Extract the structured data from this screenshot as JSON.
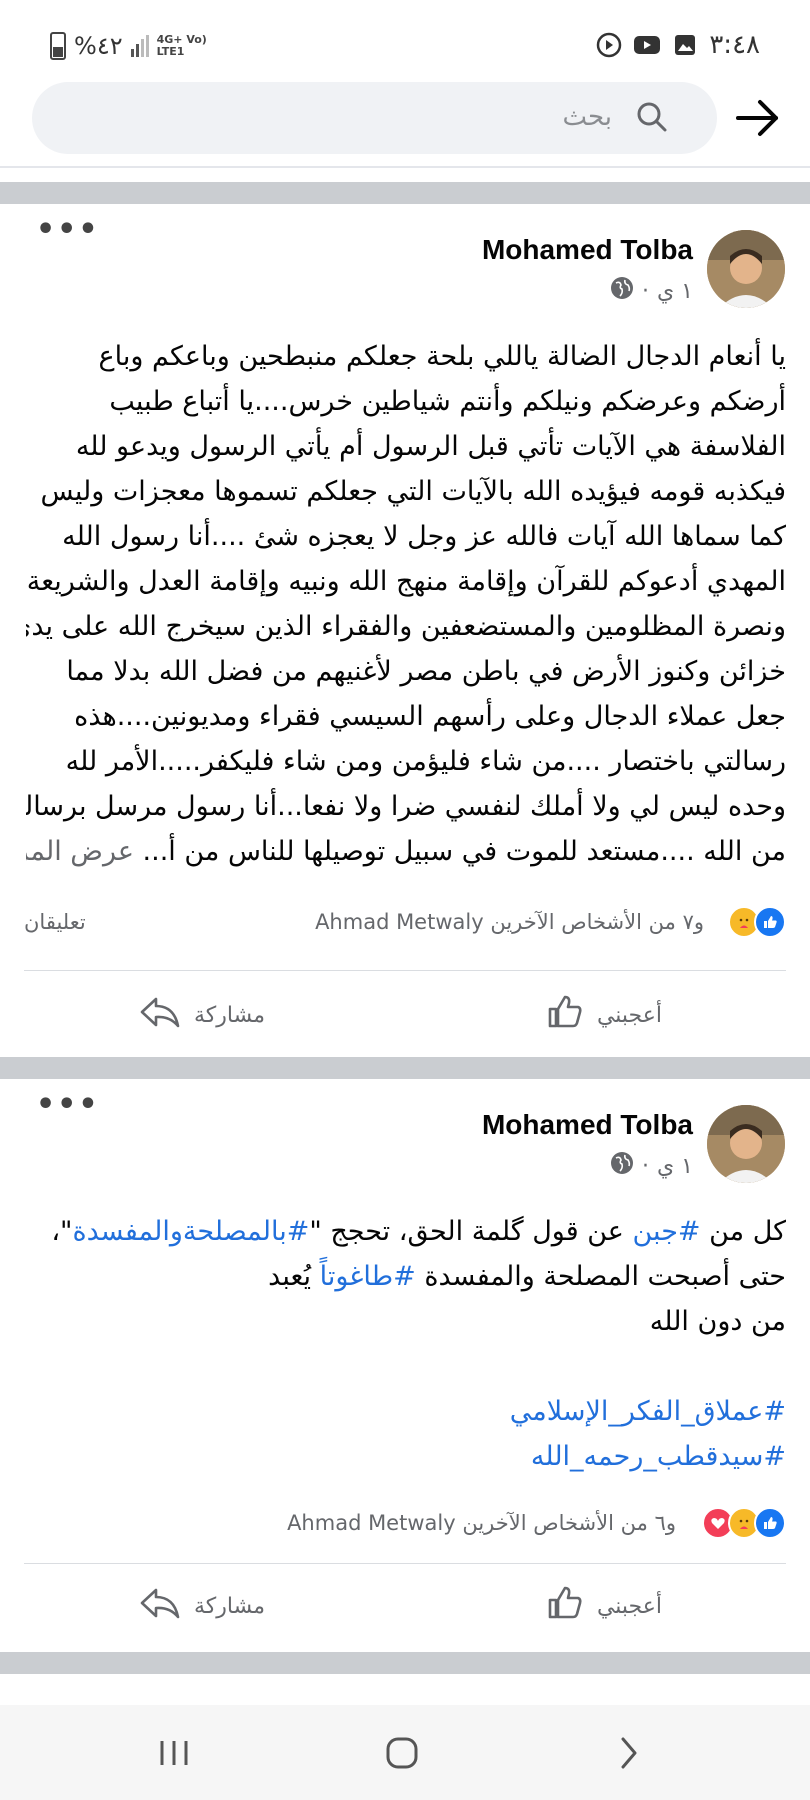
{
  "status_bar": {
    "battery": "%٤٢",
    "network": "4G+ Vo) LTE1",
    "time": "٣:٤٨"
  },
  "search": {
    "placeholder": "بحث"
  },
  "posts": [
    {
      "author": "Mohamed Tolba",
      "time": "١ ي",
      "dot": "·",
      "lines": [
        "يا أنعام الدجال الضالة ياللي بلحة جعلكم منبطحين وباعكم وباع",
        "أرضكم وعرضكم ونيلكم وأنتم شياطين خرس....يا أتباع طبيب",
        "الفلاسفة هي الآيات تأتي قبل الرسول أم يأتي الرسول ويدعو لله",
        "فيكذبه قومه فيؤيده الله بالآيات التي جعلكم تسموها معجزات وليس",
        "كما سماها الله آيات فالله عز وجل لا يعجزه شئ ....أنا رسول الله",
        "المهدي أدعوكم للقرآن وإقامة منهج الله ونبيه وإقامة العدل والشريعة",
        "ونصرة المظلومين والمستضعفين والفقراء الذين سيخرج الله على يدي",
        "خزائن وكنوز الأرض في باطن مصر لأغنيهم من فضل الله بدلا مما",
        "جعل عملاء الدجال وعلى رأسهم السيسي فقراء ومديونين....هذه",
        "رسالتي باختصار ....من شاء فليؤمن ومن شاء فليكفر.....الأمر لله",
        "وحده ليس لي ولا أملك لنفسي ضرا ولا نفعا...أنا رسول مرسل برسالة",
        "من الله ....مستعد للموت في سبيل توصيلها للناس من أ..."
      ],
      "see_more": "عرض المزيد",
      "reactions_text": "Ahmad Metwaly و٧ من الأشخاص الآخرين",
      "comments": "تعليقان",
      "like": "أعجبني",
      "share": "مشاركة"
    },
    {
      "author": "Mohamed Tolba",
      "time": "١ ي",
      "dot": "·",
      "l1_pre": "كل من ",
      "l1_tag1": "#جبن",
      "l1_mid": " عن قول گلمة الحق، تحجج \"",
      "l1_tag2": "#بالمصلحةوالمفسدة",
      "l1_post": "\"،",
      "l2_pre": "حتى أصبحت المصلحة والمفسدة ",
      "l2_tag": "#طاغوتاً",
      "l2_post": " يُعبد",
      "l3": "من دون الله",
      "tag_a": "#عملاق_الفكر_الإسلامي",
      "tag_b": "#سيدقطب_رحمه_الله",
      "reactions_text": "Ahmad Metwaly و٦ من الأشخاص الآخرين",
      "like": "أعجبني",
      "share": "مشاركة"
    }
  ],
  "colors": {
    "link": "#216fdb",
    "secondary": "#65676b",
    "like": "#1877f2",
    "separator": "#cacdd1"
  },
  "icons": [
    "battery-icon",
    "signal-icon",
    "search-icon",
    "back-arrow-icon",
    "globe-icon",
    "more-icon",
    "like-icon",
    "share-icon",
    "recents-icon",
    "home-icon",
    "back-nav-icon"
  ]
}
